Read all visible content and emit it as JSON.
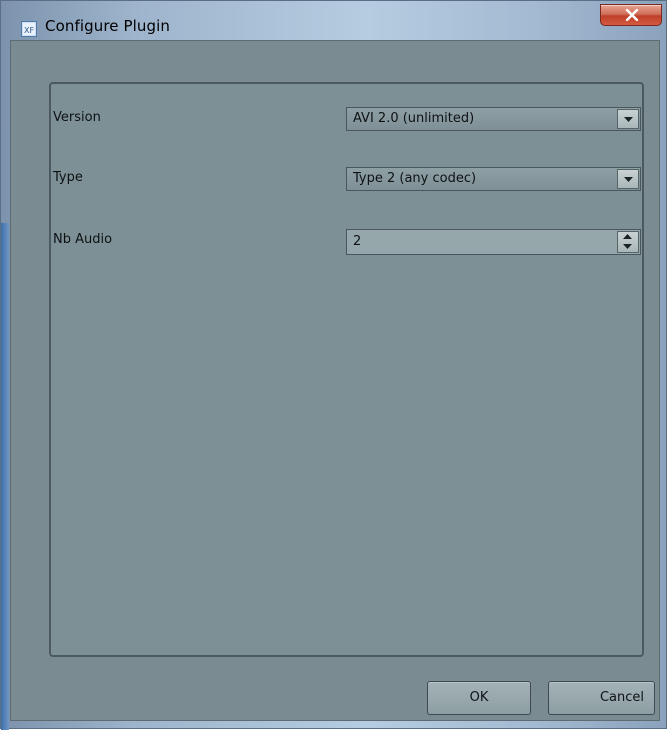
{
  "window": {
    "title": "Configure Plugin",
    "icon": "plugin-app-icon",
    "close_icon": "close-x-icon",
    "accent_close_color": "#c94a35"
  },
  "form": {
    "rows": [
      {
        "label": "Version",
        "control": "combo",
        "value": "AVI 2.0 (unlimited)"
      },
      {
        "label": "Type",
        "control": "combo",
        "value": "Type 2 (any codec)"
      },
      {
        "label": "Nb Audio",
        "control": "spinbox",
        "value": "2"
      }
    ]
  },
  "buttons": {
    "ok_label": "OK",
    "cancel_label": "Cancel"
  },
  "colors": {
    "client_background": "#7a8c91",
    "groupbox_border": "#4c5a60"
  }
}
